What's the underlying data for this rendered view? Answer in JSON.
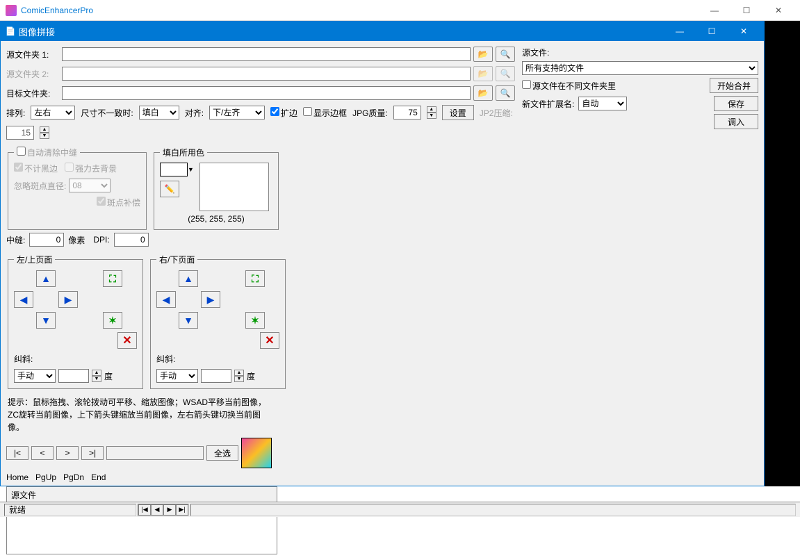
{
  "outerTitle": "ComicEnhancerPro",
  "innerTitle": "图像拼接",
  "labels": {
    "srcFolder1": "源文件夹 1:",
    "srcFolder2": "源文件夹 2:",
    "dstFolder": "目标文件夹:",
    "arrange": "排列:",
    "sizeMismatch": "尺寸不一致时:",
    "align": "对齐:",
    "expand": "扩边",
    "showBorder": "显示边框",
    "jpgQuality": "JPG质量:",
    "settings": "设置",
    "jp2": "JP2压缩:",
    "srcFile": "源文件:",
    "srcDiffFolder": "源文件在不同文件夹里",
    "startMerge": "开始合并",
    "newExt": "新文件扩展名:",
    "save": "保存",
    "load": "调入",
    "autoClear": "自动清除中缝",
    "ignoreBlack": "不计黑边",
    "strongBg": "强力去背景",
    "ignoreSpotDiameter": "忽略斑点直径:",
    "spotComp": "斑点补偿",
    "seam": "中缝:",
    "pixel": "像素",
    "dpi": "DPI:",
    "fillColor": "填白所用色",
    "rgb": "(255, 255, 255)",
    "leftPage": "左/上页面",
    "rightPage": "右/下页面",
    "skew": "纠斜:",
    "degree": "度",
    "hint": "提示：鼠标拖拽、滚轮拨动可平移、缩放图像；WSAD平移当前图像，ZC旋转当前图像，上下箭头键缩放当前图像，左右箭头键切换当前图像。",
    "selectAll": "全选",
    "home": "Home",
    "pgup": "PgUp",
    "pgdn": "PgDn",
    "end": "End",
    "fileListHeader": "源文件",
    "status": "就绪"
  },
  "values": {
    "arrange": "左右",
    "fill": "填白",
    "align": "下/左齐",
    "jpgQuality": "75",
    "jp2": "15",
    "srcFileType": "所有支持的文件",
    "ext": "自动",
    "spotDiameter": "08",
    "seam": "0",
    "dpi": "0",
    "skewMode": "手动",
    "skewVal": ""
  }
}
